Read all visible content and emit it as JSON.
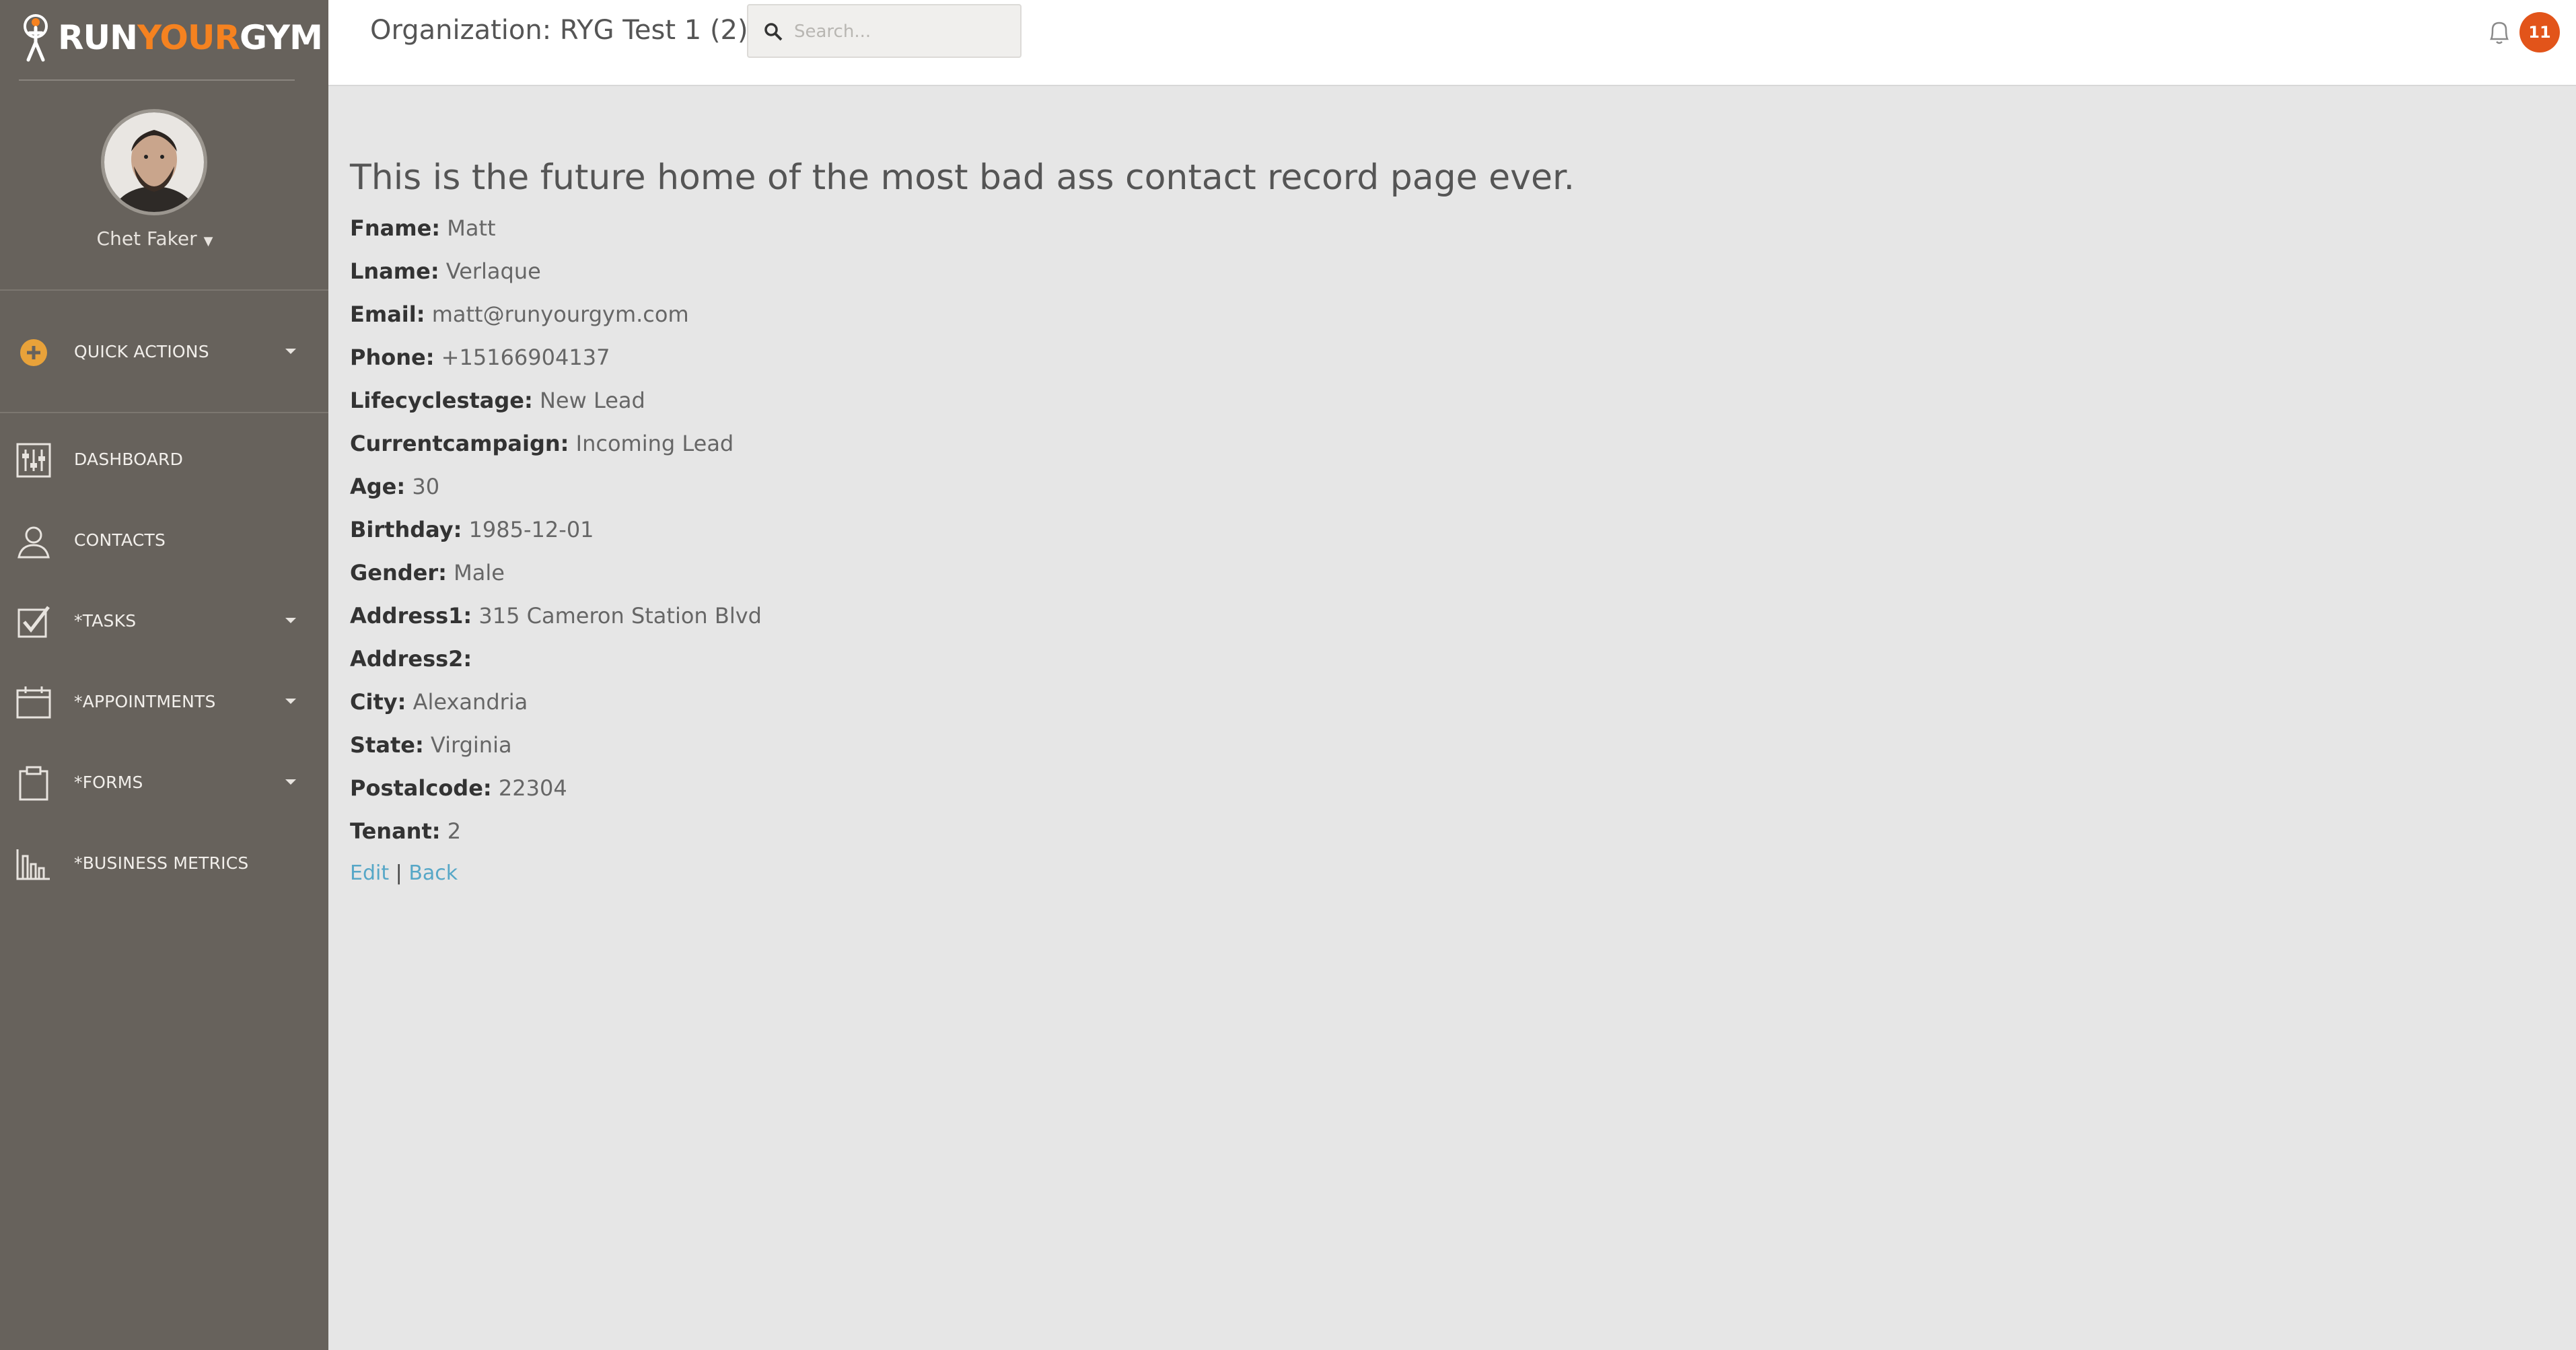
{
  "brand": {
    "logo_part1": "RUN",
    "logo_part2": "YOUR",
    "logo_part3": "GYM",
    "accent": "#f58220",
    "sidebar_bg": "#67625c"
  },
  "user": {
    "name": "Chet Faker"
  },
  "sidebar": {
    "items": [
      {
        "label": "QUICK ACTIONS",
        "icon": "plus-circle-icon",
        "has_dropdown": true
      },
      {
        "label": "DASHBOARD",
        "icon": "sliders-icon",
        "has_dropdown": false
      },
      {
        "label": "CONTACTS",
        "icon": "user-icon",
        "has_dropdown": false
      },
      {
        "label": "*TASKS",
        "icon": "checkbox-icon",
        "has_dropdown": true
      },
      {
        "label": "*APPOINTMENTS",
        "icon": "calendar-icon",
        "has_dropdown": true
      },
      {
        "label": "*FORMS",
        "icon": "clipboard-icon",
        "has_dropdown": true
      },
      {
        "label": "*BUSINESS METRICS",
        "icon": "bar-chart-icon",
        "has_dropdown": false
      }
    ]
  },
  "header": {
    "org_title": "Organization: RYG Test 1 (2)",
    "search_placeholder": "Search...",
    "notification_count": "11"
  },
  "main": {
    "heading": "This is the future home of the most bad ass contact record page ever.",
    "fields": [
      {
        "key": "Fname:",
        "value": "Matt"
      },
      {
        "key": "Lname:",
        "value": "Verlaque"
      },
      {
        "key": "Email:",
        "value": "matt@runyourgym.com"
      },
      {
        "key": "Phone:",
        "value": "+15166904137"
      },
      {
        "key": "Lifecyclestage:",
        "value": "New Lead"
      },
      {
        "key": "Currentcampaign:",
        "value": "Incoming Lead"
      },
      {
        "key": "Age:",
        "value": "30"
      },
      {
        "key": "Birthday:",
        "value": "1985-12-01"
      },
      {
        "key": "Gender:",
        "value": "Male"
      },
      {
        "key": "Address1:",
        "value": "315 Cameron Station Blvd"
      },
      {
        "key": "Address2:",
        "value": ""
      },
      {
        "key": "City:",
        "value": "Alexandria"
      },
      {
        "key": "State:",
        "value": "Virginia"
      },
      {
        "key": "Postalcode:",
        "value": "22304"
      },
      {
        "key": "Tenant:",
        "value": "2"
      }
    ],
    "edit_label": "Edit",
    "separator": "|",
    "back_label": "Back"
  }
}
